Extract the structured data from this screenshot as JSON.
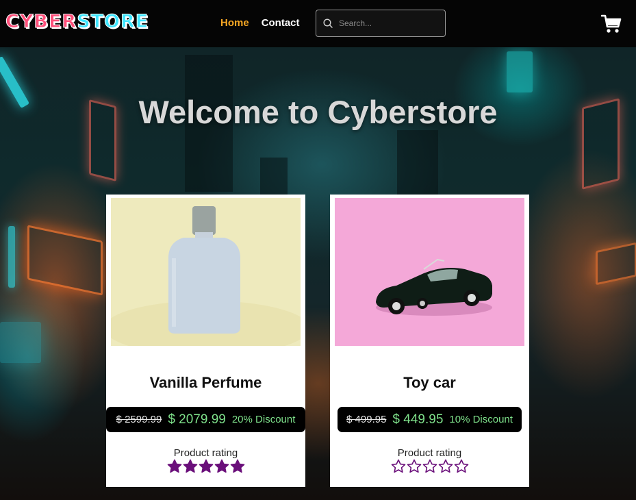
{
  "header": {
    "logo_part1": "CYBER",
    "logo_part2": "STORE",
    "nav": {
      "home": "Home",
      "contact": "Contact"
    },
    "search": {
      "placeholder": "Search...",
      "value": ""
    },
    "icons": {
      "search": "search-icon",
      "cart": "shopping-cart-icon"
    },
    "colors": {
      "logo_pink": "#ff4f7a",
      "logo_cyan": "#3fe6ff",
      "nav_active": "#f5a623"
    }
  },
  "hero": {
    "title": "Welcome to Cyberstore"
  },
  "products": [
    {
      "name": "Vanilla Perfume",
      "old_price": "$ 2599.99",
      "new_price": "$ 2079.99",
      "discount": "20% Discount",
      "rating_label": "Product rating",
      "rating": 5,
      "rating_max": 5,
      "image": "perfume-bottle"
    },
    {
      "name": "Toy car",
      "old_price": "$ 499.95",
      "new_price": "$ 449.95",
      "discount": "10% Discount",
      "rating_label": "Product rating",
      "rating": 0,
      "rating_max": 5,
      "image": "toy-car"
    }
  ],
  "colors": {
    "price_green": "#7ee08a",
    "star_purple": "#6a0f7a"
  }
}
